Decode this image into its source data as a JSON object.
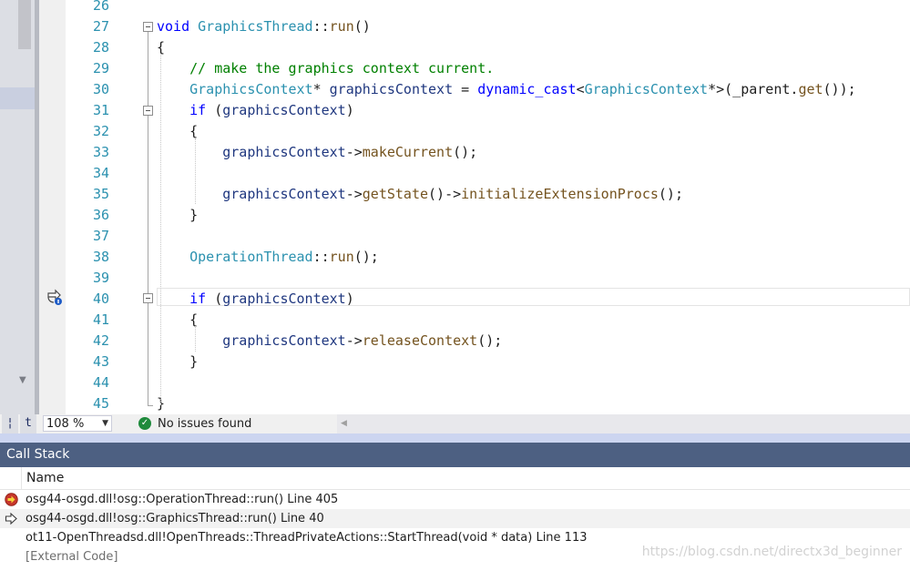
{
  "editor": {
    "lines": [
      {
        "num": "26",
        "segs": []
      },
      {
        "num": "27",
        "segs": [
          {
            "c": "kw",
            "t": "void "
          },
          {
            "c": "ty",
            "t": "GraphicsThread"
          },
          {
            "c": "",
            "t": "::"
          },
          {
            "c": "fn",
            "t": "run"
          },
          {
            "c": "",
            "t": "()"
          }
        ]
      },
      {
        "num": "28",
        "segs": [
          {
            "c": "",
            "t": "{"
          }
        ]
      },
      {
        "num": "29",
        "segs": [
          {
            "c": "cm",
            "t": "    // make the graphics context current."
          }
        ]
      },
      {
        "num": "30",
        "segs": [
          {
            "c": "ty",
            "t": "    GraphicsContext"
          },
          {
            "c": "",
            "t": "* "
          },
          {
            "c": "vr",
            "t": "graphicsContext"
          },
          {
            "c": "",
            "t": " = "
          },
          {
            "c": "kw",
            "t": "dynamic_cast"
          },
          {
            "c": "",
            "t": "<"
          },
          {
            "c": "ty",
            "t": "GraphicsContext"
          },
          {
            "c": "",
            "t": "*>(_parent."
          },
          {
            "c": "fn",
            "t": "get"
          },
          {
            "c": "",
            "t": "());"
          }
        ]
      },
      {
        "num": "31",
        "segs": [
          {
            "c": "kw",
            "t": "    if "
          },
          {
            "c": "",
            "t": "("
          },
          {
            "c": "vr",
            "t": "graphicsContext"
          },
          {
            "c": "",
            "t": ")"
          }
        ]
      },
      {
        "num": "32",
        "segs": [
          {
            "c": "",
            "t": "    {"
          }
        ]
      },
      {
        "num": "33",
        "segs": [
          {
            "c": "vr",
            "t": "        graphicsContext"
          },
          {
            "c": "",
            "t": "->"
          },
          {
            "c": "fn",
            "t": "makeCurrent"
          },
          {
            "c": "",
            "t": "();"
          }
        ]
      },
      {
        "num": "34",
        "segs": []
      },
      {
        "num": "35",
        "segs": [
          {
            "c": "vr",
            "t": "        graphicsContext"
          },
          {
            "c": "",
            "t": "->"
          },
          {
            "c": "fn",
            "t": "getState"
          },
          {
            "c": "",
            "t": "()->"
          },
          {
            "c": "fn",
            "t": "initializeExtensionProcs"
          },
          {
            "c": "",
            "t": "();"
          }
        ]
      },
      {
        "num": "36",
        "segs": [
          {
            "c": "",
            "t": "    }"
          }
        ]
      },
      {
        "num": "37",
        "segs": []
      },
      {
        "num": "38",
        "segs": [
          {
            "c": "ty",
            "t": "    OperationThread"
          },
          {
            "c": "",
            "t": "::"
          },
          {
            "c": "fn",
            "t": "run"
          },
          {
            "c": "",
            "t": "();"
          }
        ]
      },
      {
        "num": "39",
        "segs": []
      },
      {
        "num": "40",
        "segs": [
          {
            "c": "kw",
            "t": "    if "
          },
          {
            "c": "",
            "t": "("
          },
          {
            "c": "vr",
            "t": "graphicsContext"
          },
          {
            "c": "",
            "t": ")"
          }
        ]
      },
      {
        "num": "41",
        "segs": [
          {
            "c": "",
            "t": "    {"
          }
        ]
      },
      {
        "num": "42",
        "segs": [
          {
            "c": "vr",
            "t": "        graphicsContext"
          },
          {
            "c": "",
            "t": "->"
          },
          {
            "c": "fn",
            "t": "releaseContext"
          },
          {
            "c": "",
            "t": "();"
          }
        ]
      },
      {
        "num": "43",
        "segs": [
          {
            "c": "",
            "t": "    }"
          }
        ]
      },
      {
        "num": "44",
        "segs": []
      },
      {
        "num": "45",
        "segs": [
          {
            "c": "",
            "t": "}"
          }
        ]
      }
    ],
    "current_line": "40"
  },
  "status": {
    "split_left": "¦",
    "split_right": "t",
    "zoom": "108 %",
    "issues_check": "✓",
    "issues": "No issues found"
  },
  "callstack": {
    "title": "Call Stack",
    "column_name": "Name",
    "rows": [
      {
        "text": "osg44-osgd.dll!osg::OperationThread::run() Line 405",
        "icon": "current-frame-arrow-icon"
      },
      {
        "text": "osg44-osgd.dll!osg::GraphicsThread::run() Line 40",
        "icon": "caller-frame-arrow-icon"
      },
      {
        "text": "ot11-OpenThreadsd.dll!OpenThreads::ThreadPrivateActions::StartThread(void * data) Line 113",
        "icon": ""
      },
      {
        "text": "[External Code]",
        "icon": ""
      }
    ],
    "watermark": "https://blog.csdn.net/directx3d_beginner"
  },
  "colors": {
    "keyword": "#0000ff",
    "type": "#2b91af",
    "function": "#74531f",
    "comment": "#008000",
    "variable": "#1f377f",
    "toolwindow_title": "#4d6082"
  }
}
